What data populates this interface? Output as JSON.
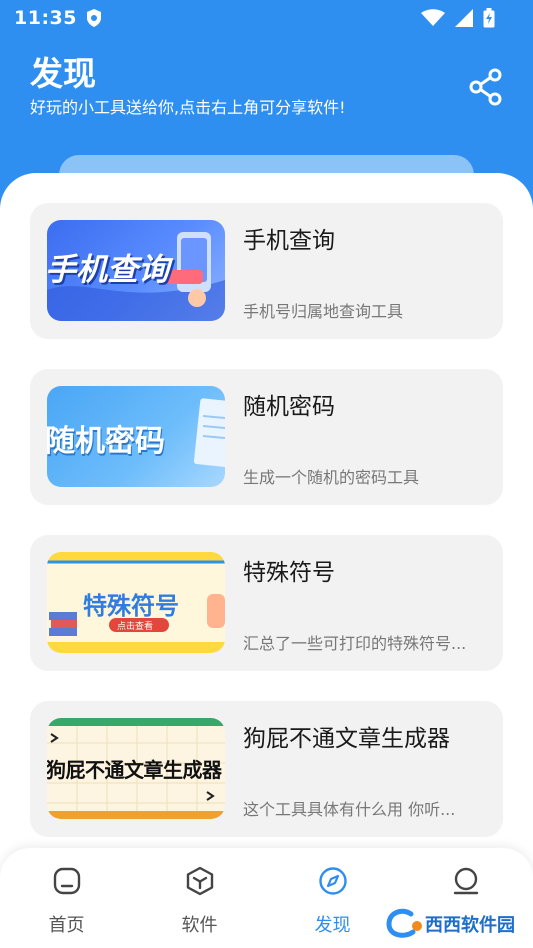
{
  "status_bar": {
    "time": "11:35"
  },
  "header": {
    "title": "发现",
    "subtitle": "好玩的小工具送给你,点击右上角可分享软件!"
  },
  "cards": [
    {
      "title": "手机查询",
      "desc": "手机号归属地查询工具",
      "thumb_text": "手机查询"
    },
    {
      "title": "随机密码",
      "desc": "生成一个随机的密码工具",
      "thumb_text": "随机密码"
    },
    {
      "title": "特殊符号",
      "desc": "汇总了一些可打印的特殊符号...",
      "thumb_text": "特殊符号",
      "thumb_badge": "点击查看"
    },
    {
      "title": "狗屁不通文章生成器",
      "desc": "这个工具具体有什么用 你听...",
      "thumb_text": "狗屁不通文章生成器"
    }
  ],
  "bottom_nav": {
    "items": [
      {
        "label": "首页",
        "icon": "home-icon"
      },
      {
        "label": "软件",
        "icon": "box-icon"
      },
      {
        "label": "发现",
        "icon": "compass-icon",
        "active": true
      },
      {
        "label": "",
        "icon": "user-icon"
      }
    ]
  },
  "watermark": {
    "text": "西西软件园"
  },
  "colors": {
    "primary": "#2f8ff0",
    "card_bg": "#f2f2f2",
    "text_dark": "#1a1a1a",
    "text_muted": "#777777"
  }
}
